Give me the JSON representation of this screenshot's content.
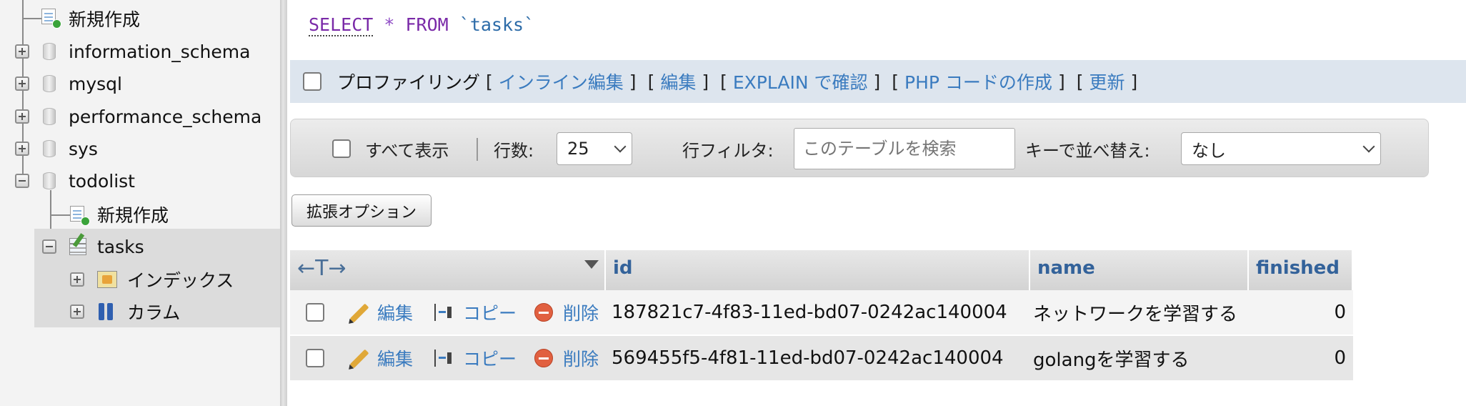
{
  "navigation": {
    "top_new": "新規作成",
    "databases": [
      "information_schema",
      "mysql",
      "performance_schema",
      "sys",
      "todolist"
    ],
    "todolist_new": "新規作成",
    "table_name": "tasks",
    "sub_items": [
      "インデックス",
      "カラム"
    ]
  },
  "sql": {
    "select": "SELECT",
    "star": "*",
    "from": "FROM",
    "table": "`tasks`"
  },
  "profiling": {
    "label": "プロファイリング",
    "links": [
      "インライン編集",
      "編集",
      "EXPLAIN で確認",
      "PHP コードの作成",
      "更新"
    ]
  },
  "navigation_bar": {
    "show_all": "すべて表示",
    "rows_label": "行数:",
    "rows_value": "25",
    "filter_label": "行フィルタ:",
    "filter_placeholder": "このテーブルを検索",
    "sort_label": "キーで並べ替え:",
    "sort_value": "なし"
  },
  "extended_options": "拡張オプション",
  "table": {
    "arrows": "←T→",
    "columns": [
      "id",
      "name",
      "finished"
    ],
    "actions": {
      "edit": "編集",
      "copy": "コピー",
      "delete": "削除"
    },
    "rows": [
      {
        "id": "187821c7-4f83-11ed-bd07-0242ac140004",
        "name": "ネットワークを学習する",
        "finished": "0"
      },
      {
        "id": "569455f5-4f81-11ed-bd07-0242ac140004",
        "name": "golangを学習する",
        "finished": "0"
      }
    ]
  },
  "colors": {
    "link": "#3a7bbf",
    "header_text": "#33629a",
    "sql_keyword": "#7a2aa8",
    "delete_red": "#e16040"
  }
}
